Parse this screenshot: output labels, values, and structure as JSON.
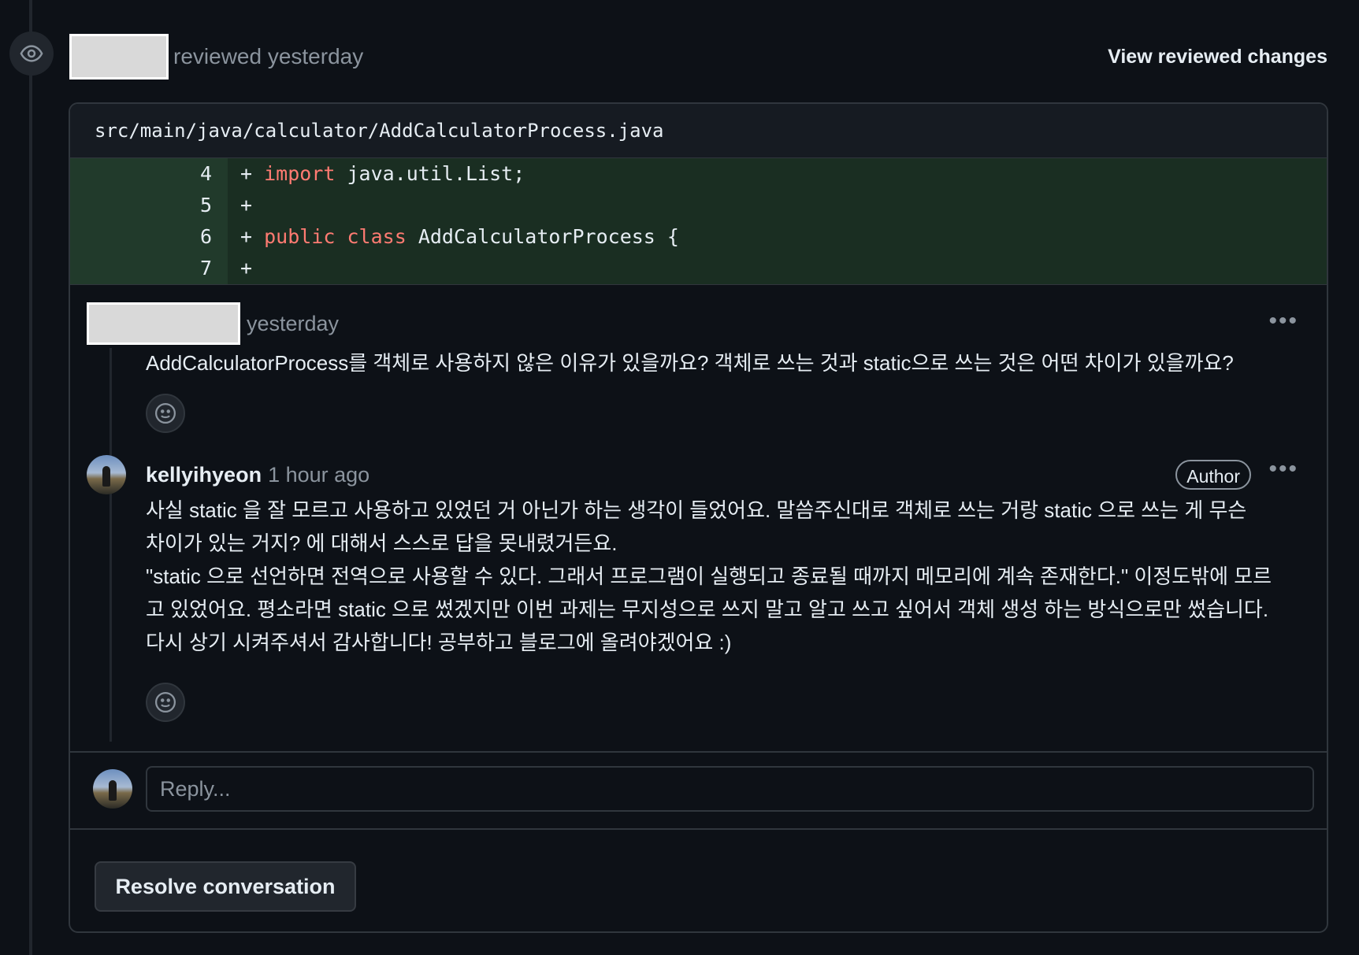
{
  "review": {
    "status_text": "reviewed yesterday",
    "view_changes_label": "View reviewed changes",
    "icon": "eye-icon"
  },
  "file": {
    "path": "src/main/java/calculator/AddCalculatorProcess.java"
  },
  "diff": {
    "lines": [
      {
        "num": "4",
        "marker": "+",
        "keywords": [
          "import"
        ],
        "rest": " java.util.List;"
      },
      {
        "num": "5",
        "marker": "+",
        "keywords": [],
        "rest": ""
      },
      {
        "num": "6",
        "marker": "+",
        "keywords": [
          "public",
          "class"
        ],
        "rest": " AddCalculatorProcess {"
      },
      {
        "num": "7",
        "marker": "+",
        "keywords": [],
        "rest": ""
      }
    ]
  },
  "comments": [
    {
      "author": "",
      "time": "yesterday",
      "more_label": "•••",
      "body": [
        "AddCalculatorProcess를 객체로 사용하지 않은 이유가 있을까요? 객체로 쓰는 것과 static으로 쓰는 것은 어떤 차이가 있을까요?"
      ]
    },
    {
      "author": "kellyihyeon",
      "time": "1 hour ago",
      "badge": "Author",
      "more_label": "•••",
      "body": [
        "사실 static 을 잘 모르고 사용하고 있었던 거 아닌가 하는 생각이 들었어요. 말씀주신대로 객체로 쓰는 거랑 static 으로 쓰는 게 무슨",
        "차이가 있는 거지? 에 대해서 스스로 답을 못내렸거든요.",
        "\"static 으로 선언하면 전역으로 사용할 수 있다. 그래서 프로그램이 실행되고 종료될 때까지 메모리에 계속 존재한다.\" 이정도밖에 모르",
        "고 있었어요. 평소라면 static 으로 썼겠지만 이번 과제는 무지성으로 쓰지 말고 알고 쓰고 싶어서 객체 생성 하는 방식으로만 썼습니다.",
        "다시 상기 시켜주셔서 감사합니다! 공부하고 블로그에 올려야겠어요 :)"
      ]
    }
  ],
  "reply": {
    "placeholder": "Reply..."
  },
  "resolve_label": "Resolve conversation",
  "colors": {
    "background": "#0d1117",
    "added_line_bg": "#1a2e22",
    "keyword": "#ff7b72",
    "muted": "#8b949e"
  }
}
